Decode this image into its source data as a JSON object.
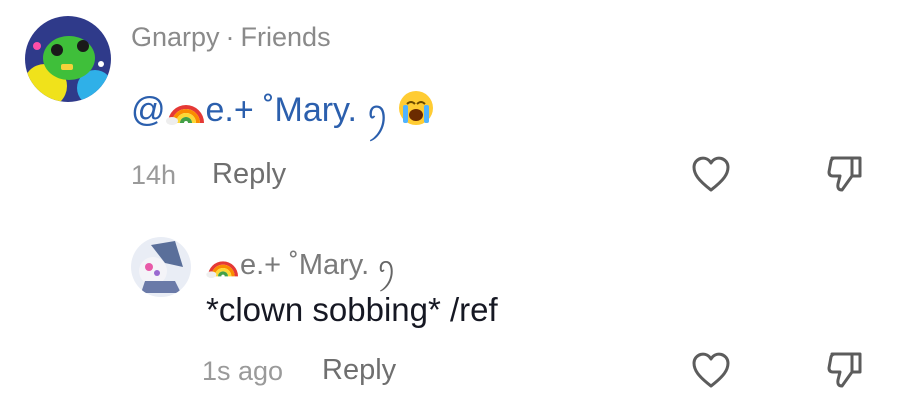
{
  "comments": [
    {
      "author": "Gnarpy",
      "separator": "·",
      "relation": "Friends",
      "mention_at": "@",
      "mention_name": "e.+ ˚Mary.",
      "mention_suffix": "ꪆ",
      "timestamp": "14h",
      "reply_label": "Reply"
    },
    {
      "author_display": "e.+ ˚Mary.",
      "author_suffix": "ꪆ",
      "text": "*clown sobbing* /ref",
      "timestamp": "1s ago",
      "reply_label": "Reply"
    }
  ],
  "icons": {
    "like": "heart-outline-icon",
    "dislike": "thumbs-down-outline-icon",
    "crying_emoji": "loudly-crying-face-emoji",
    "rainbow_emoji": "rainbow-emoji"
  }
}
